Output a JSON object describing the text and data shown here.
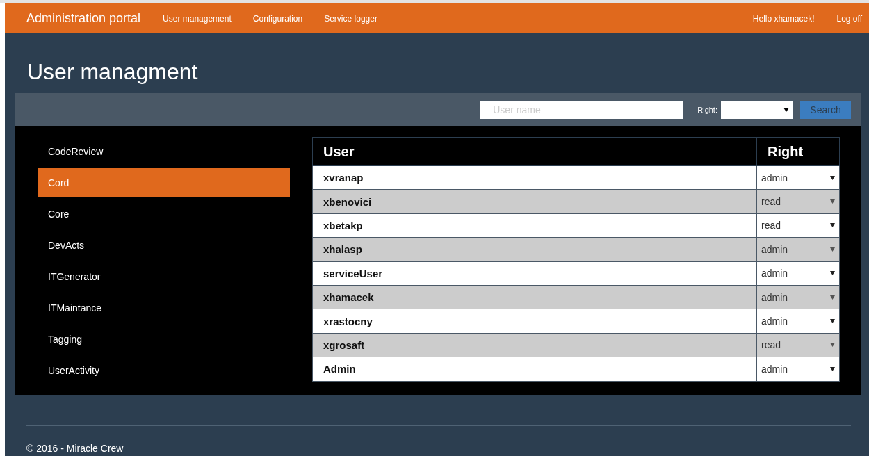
{
  "navbar": {
    "brand": "Administration portal",
    "links": [
      "User management",
      "Configuration",
      "Service logger"
    ],
    "greeting": "Hello xhamacek!",
    "logoff": "Log off"
  },
  "page_title": "User managment",
  "search_bar": {
    "user_field": {
      "placeholder": "User name"
    },
    "right_label": "Right:",
    "search_button": "Search"
  },
  "projects": [
    {
      "name": "CodeReview",
      "selected": false
    },
    {
      "name": "Cord",
      "selected": true
    },
    {
      "name": "Core",
      "selected": false
    },
    {
      "name": "DevActs",
      "selected": false
    },
    {
      "name": "ITGenerator",
      "selected": false
    },
    {
      "name": "ITMaintance",
      "selected": false
    },
    {
      "name": "Tagging",
      "selected": false
    },
    {
      "name": "UserActivity",
      "selected": false
    }
  ],
  "table": {
    "columns": [
      "User",
      "Right"
    ],
    "rows": [
      {
        "user": "xvranap",
        "right": "admin"
      },
      {
        "user": "xbenovici",
        "right": "read"
      },
      {
        "user": "xbetakp",
        "right": "read"
      },
      {
        "user": "xhalasp",
        "right": "admin"
      },
      {
        "user": "serviceUser",
        "right": "admin"
      },
      {
        "user": "xhamacek",
        "right": "admin"
      },
      {
        "user": "xrastocny",
        "right": "admin"
      },
      {
        "user": "xgrosaft",
        "right": "read"
      },
      {
        "user": "Admin",
        "right": "admin"
      }
    ]
  },
  "footer": "© 2016 - Miracle Crew"
}
